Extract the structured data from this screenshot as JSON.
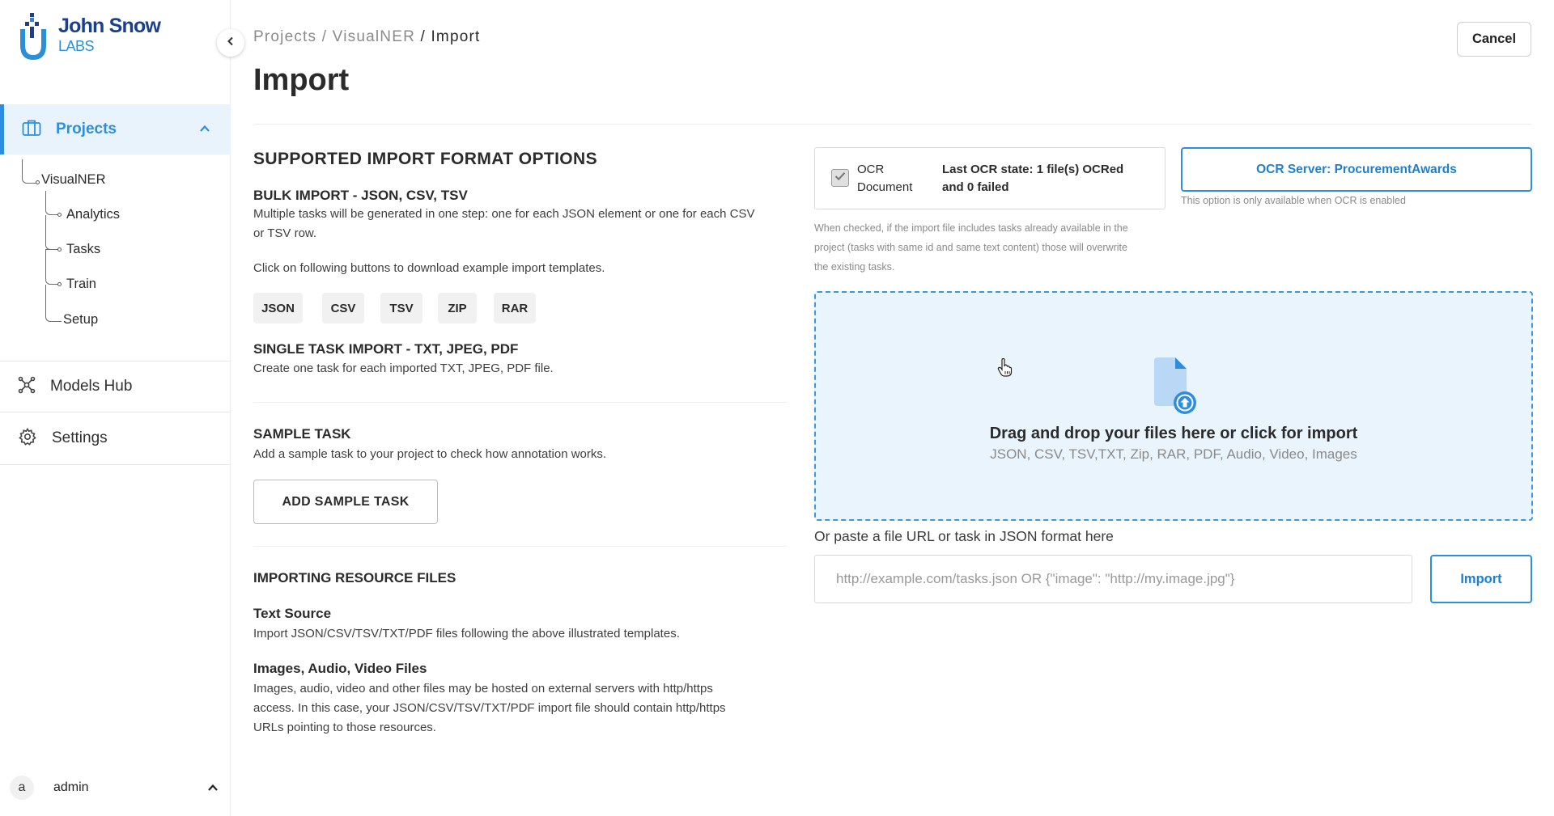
{
  "brand": {
    "line1": "John Snow",
    "line2": "LABS"
  },
  "sidebar": {
    "projects_label": "Projects",
    "tree": {
      "project": "VisualNER",
      "children": [
        "Analytics",
        "Tasks",
        "Train",
        "Setup"
      ]
    },
    "models_hub_label": "Models Hub",
    "settings_label": "Settings",
    "user": {
      "initial": "a",
      "name": "admin"
    }
  },
  "header": {
    "breadcrumb": [
      "Projects",
      "VisualNER",
      "Import"
    ],
    "title": "Import",
    "cancel_label": "Cancel"
  },
  "left": {
    "section_title": "SUPPORTED IMPORT FORMAT OPTIONS",
    "bulk": {
      "title": "BULK IMPORT - JSON, CSV, TSV",
      "desc_line1": "Multiple tasks will be generated in one step: one for each JSON element or one for each CSV",
      "desc_line2": "or TSV row.",
      "templates_hint": "Click on following buttons to download example import templates.",
      "formats": [
        "JSON",
        "CSV",
        "TSV",
        "ZIP",
        "RAR"
      ]
    },
    "single": {
      "title": "SINGLE TASK IMPORT - TXT, JPEG, PDF",
      "desc": "Create one task for each imported TXT, JPEG, PDF file."
    },
    "sample": {
      "title": "SAMPLE TASK",
      "desc": "Add a sample task to your project to check how annotation works.",
      "button": "ADD SAMPLE TASK"
    },
    "resources": {
      "title": "IMPORTING RESOURCE FILES",
      "text_source_title": "Text Source",
      "text_source_desc": "Import JSON/CSV/TSV/TXT/PDF files following the above illustrated templates.",
      "media_title": "Images, Audio, Video Files",
      "media_line1": "Images, audio, video and other files may be hosted on external servers with http/https",
      "media_line2": "access. In this case, your JSON/CSV/TSV/TXT/PDF import file should contain http/https",
      "media_line3": "URLs pointing to those resources."
    }
  },
  "right": {
    "ocr": {
      "label_line1": "OCR",
      "label_line2": "Document",
      "checked": true,
      "state_line1": "Last OCR state: 1 file(s) OCRed",
      "state_line2": "and 0 failed"
    },
    "ocr_server_label": "OCR Server: ProcurementAwards",
    "ocr_server_note": "This option is only available when OCR is enabled",
    "overwrite_line1": "When checked, if the import file includes tasks already available in the",
    "overwrite_line2": "project (tasks with same id and same text content) those will overwrite",
    "overwrite_line3": "the existing tasks.",
    "dropzone": {
      "title": "Drag and drop your files here or click for import",
      "subtitle": "JSON, CSV, TSV,TXT, Zip, RAR, PDF, Audio, Video, Images"
    },
    "paste_label": "Or paste a file URL or task in JSON format here",
    "url_placeholder": "http://example.com/tasks.json OR {\"image\": \"http://my.image.jpg\"}",
    "import_label": "Import"
  },
  "colors": {
    "accent": "#2d8ee0",
    "accent_bg": "#e8f3fc",
    "dropzone_bg": "#e9f4fd",
    "brand_dark": "#1b3f8f"
  }
}
